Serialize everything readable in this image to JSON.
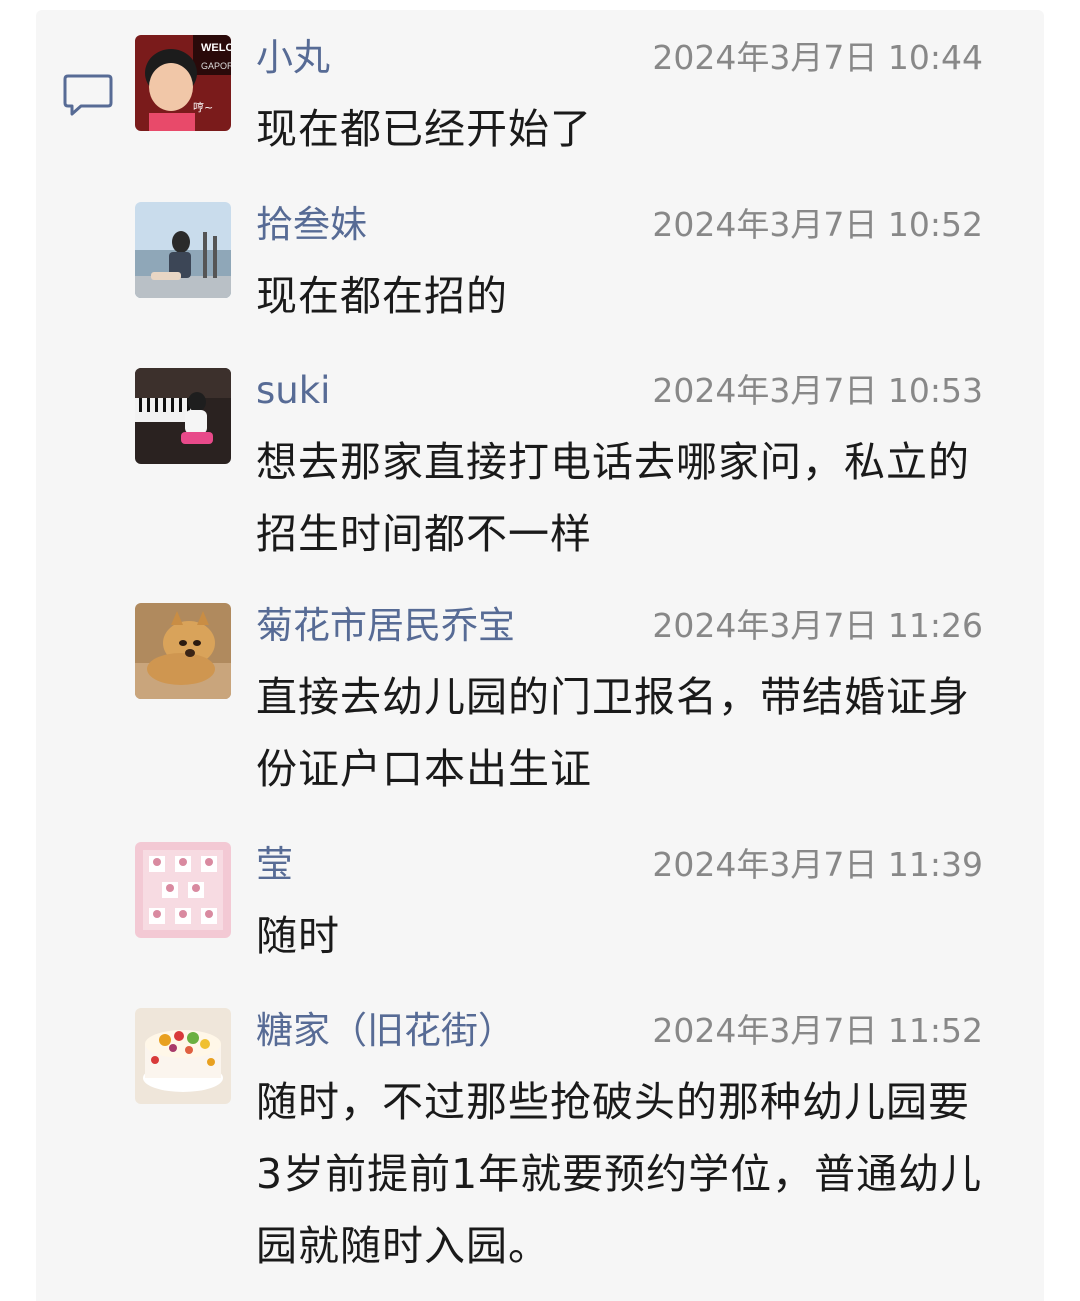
{
  "comments": [
    {
      "name": "小丸",
      "time": "2024年3月7日 10:44",
      "text": "现在都已经开始了",
      "avatar": "boy-photo"
    },
    {
      "name": "拾叁妹",
      "time": "2024年3月7日 10:52",
      "text": "现在都在招的",
      "avatar": "seaside-photo"
    },
    {
      "name": "suki",
      "time": "2024年3月7日 10:53",
      "text": "想去那家直接打电话去哪家问，私立的招生时间都不一样",
      "avatar": "piano-photo"
    },
    {
      "name": "菊花市居民乔宝",
      "time": "2024年3月7日 11:26",
      "text": "直接去幼儿园的门卫报名，带结婚证身份证户口本出生证",
      "avatar": "dog-photo"
    },
    {
      "name": "莹",
      "time": "2024年3月7日 11:39",
      "text": "随时",
      "avatar": "pink-collage"
    },
    {
      "name": "糖家（旧花街）",
      "time": "2024年3月7日 11:52",
      "text": "随时，不过那些抢破头的那种幼儿园要3岁前提前1年就要预约学位，普通幼儿园就随时入园。",
      "avatar": "cake-photo"
    }
  ],
  "avatar_text": {
    "sign_top": "WELCO",
    "sign_bottom": "GAPORE",
    "caption": "哼~"
  },
  "colors": {
    "name": "#576b95",
    "time": "#888888",
    "text": "#1a1a1a",
    "card": "#f6f6f6",
    "icon": "#576b95"
  },
  "icons": {
    "comment": "speech-bubble-icon"
  }
}
